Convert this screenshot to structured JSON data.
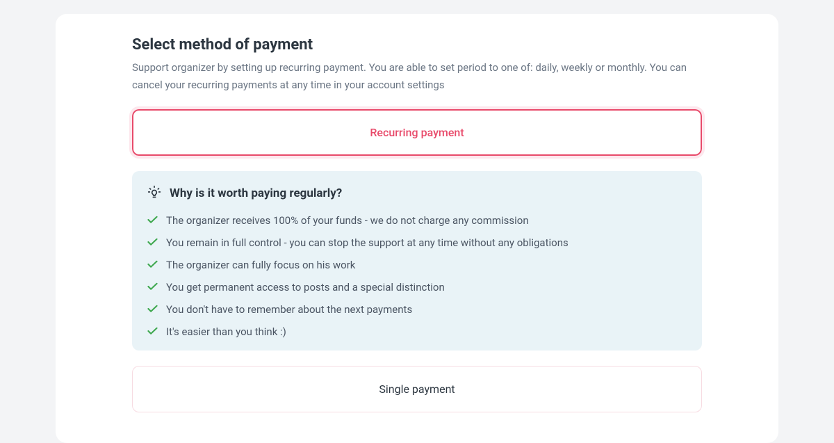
{
  "header": {
    "title": "Select method of payment",
    "description": "Support organizer by setting up recurring payment. You are able to set period to one of: daily, weekly or monthly. You can cancel your recurring payments at any time in your account settings"
  },
  "options": {
    "recurring_label": "Recurring payment",
    "single_label": "Single payment"
  },
  "benefits": {
    "title": "Why is it worth paying regularly?",
    "items": [
      "The organizer receives 100% of your funds - we do not charge any commission",
      "You remain in full control - you can stop the support at any time without any obligations",
      "The organizer can fully focus on his work",
      "You get permanent access to posts and a special distinction",
      "You don't have to remember about the next payments",
      "It's easier than you think :)"
    ]
  },
  "colors": {
    "accent": "#e84a6a",
    "info_bg": "#e9f3f7",
    "check": "#3fa84f"
  }
}
